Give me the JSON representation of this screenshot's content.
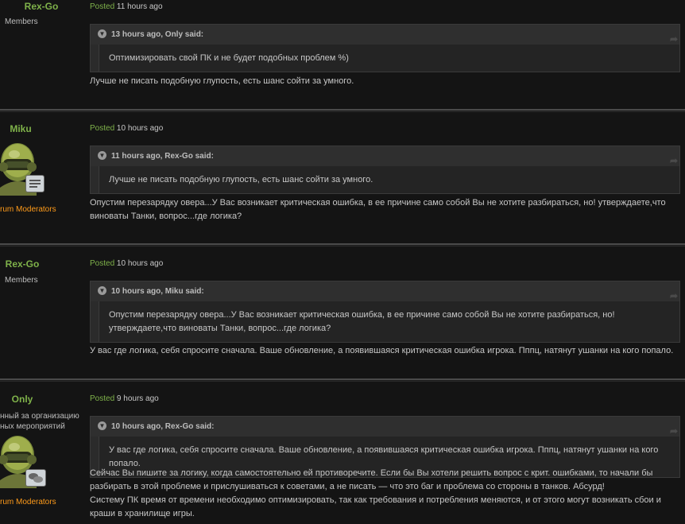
{
  "posts": [
    {
      "author": "Rex-Go",
      "group": "Members",
      "title": "",
      "role": "",
      "posted_label": "Posted",
      "posted_time": "11 hours ago",
      "quote_header": "13 hours ago, Only said:",
      "quote_text": "Оптимизировать свой ПК и не будет подобных проблем %)",
      "text": "Лучше не писать подобную глупость, есть шанс сойти за умного."
    },
    {
      "author": "Miku",
      "group": "",
      "title": "",
      "role": "rum Moderators",
      "posted_label": "Posted",
      "posted_time": "10 hours ago",
      "quote_header": "11 hours ago, Rex-Go said:",
      "quote_text": "Лучше не писать подобную глупость, есть шанс сойти за умного.",
      "text": "Опустим перезарядку овера...У Вас возникает критическая ошибка, в ее причине само собой Вы не хотите разбираться, но! утверждаете,что виноваты Танки, вопрос...где логика?"
    },
    {
      "author": "Rex-Go",
      "group": "Members",
      "title": "",
      "role": "",
      "posted_label": "Posted",
      "posted_time": "10 hours ago",
      "quote_header": "10 hours ago, Miku said:",
      "quote_text": "Опустим перезарядку овера...У Вас возникает критическая ошибка, в ее причине само собой Вы не хотите разбираться, но! утверждаете,что виноваты Танки, вопрос...где логика?",
      "text": "У вас где логика, себя спросите сначала. Ваше обновление, а появившаяся критическая ошибка игрока. Пппц, натянут ушанки на кого попало."
    },
    {
      "author": "Only",
      "group": "",
      "title": "нный за организацию\nных мероприятий",
      "role": "rum Moderators",
      "posted_label": "Posted",
      "posted_time": "9 hours ago",
      "quote_header": "10 hours ago, Rex-Go said:",
      "quote_text": "У вас где логика, себя спросите сначала. Ваше обновление, а появившаяся критическая ошибка игрока. Пппц, натянут ушанки на кого попало.",
      "text": "Сейчас Вы пишите за логику, когда самостоятельно ей противоречите. Если бы Вы хотели решить вопрос с крит. ошибками, то начали бы разбирать в этой проблеме и прислушиваться к советами, а не писать — что это баг и проблема со стороны в танков. Абсурд!\nСистему ПК время от времени необходимо оптимизировать, так как требования и потребления меняются, и от этого могут возникать сбои и краши в хранилище игры."
    }
  ],
  "colors": {
    "author": "#7fb24a",
    "posted": "#7fb24a",
    "moderator": "#ff9b1a",
    "background": "#141414"
  },
  "icons": {
    "quote_toggle": "chevron-down-icon",
    "quote_share": "share-icon",
    "moderator_badge_1": "message-icon",
    "moderator_badge_2": "chat-bubbles-icon"
  }
}
